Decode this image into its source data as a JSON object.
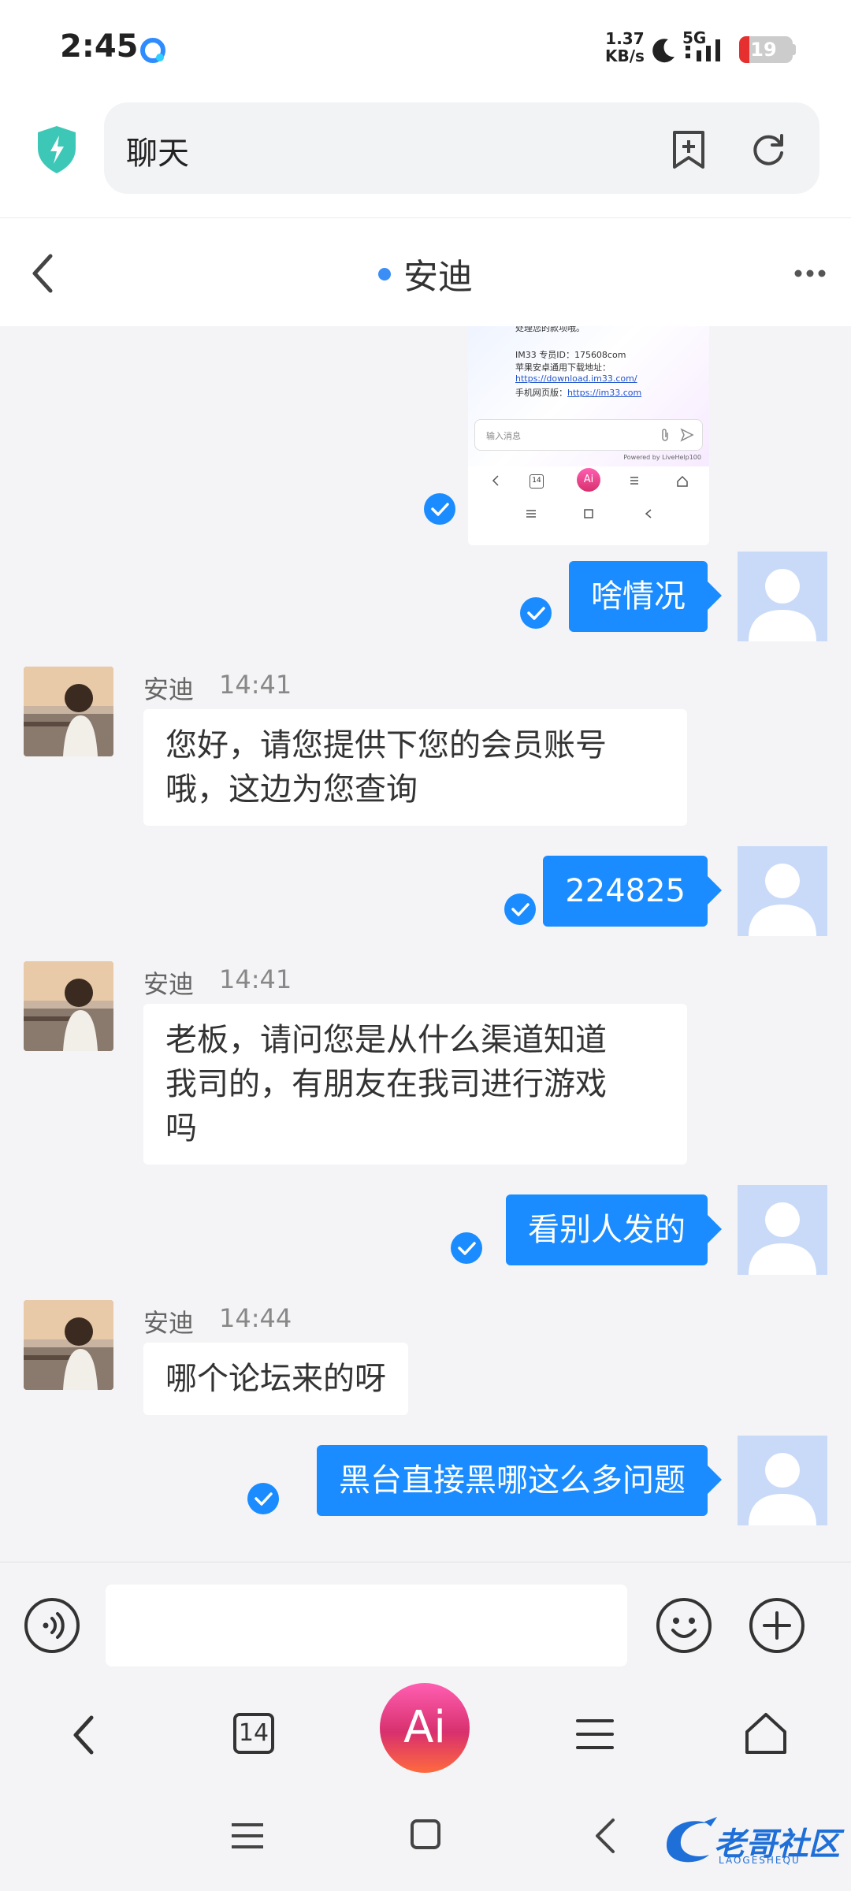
{
  "status_bar": {
    "time": "2:45",
    "speed_value": "1.37",
    "speed_unit": "KB/s",
    "network": "5G",
    "battery": "19",
    "battery_fraction": 0.19
  },
  "browser": {
    "url_text": "聊天",
    "shield_color": "#3cc7b7"
  },
  "chat": {
    "title": "安迪",
    "online_color": "#3a8ef6"
  },
  "shared_screenshot": {
    "line1": "处理您的款项哦。",
    "line2": "IM33 专员ID：175608com",
    "line3": "苹果安卓通用下载地址：",
    "line4": "https://download.im33.com/",
    "line5_prefix": "手机网页版：",
    "line5_link": "https://im33.com",
    "input_placeholder": "输入消息",
    "powered_by": "Powered by LiveHelp100",
    "tab_count": "14",
    "ai_label": "Ai"
  },
  "messages": [
    {
      "from": "me",
      "text": "啥情况"
    },
    {
      "from": "other",
      "name": "安迪",
      "time": "14:41",
      "lines": [
        "您好，请您提供下您的会员账号",
        "哦，这边为您查询"
      ]
    },
    {
      "from": "me",
      "text": "224825"
    },
    {
      "from": "other",
      "name": "安迪",
      "time": "14:41",
      "lines": [
        "老板，请问您是从什么渠道知道",
        "我司的，有朋友在我司进行游戏",
        "吗"
      ]
    },
    {
      "from": "me",
      "text": "看别人发的"
    },
    {
      "from": "other",
      "name": "安迪",
      "time": "14:44",
      "lines": [
        "哪个论坛来的呀"
      ]
    },
    {
      "from": "me",
      "text": "黑台直接黑哪这么多问题"
    }
  ],
  "input": {
    "value": "",
    "placeholder": ""
  },
  "toolbar": {
    "tab_count": "14",
    "ai_label": "Ai"
  },
  "watermark": {
    "text": "老哥社区",
    "sub": "LAOGESHEQU"
  },
  "colors": {
    "my_bubble": "#1a8cff",
    "other_bubble": "#ffffff",
    "background": "#f4f4f6"
  }
}
